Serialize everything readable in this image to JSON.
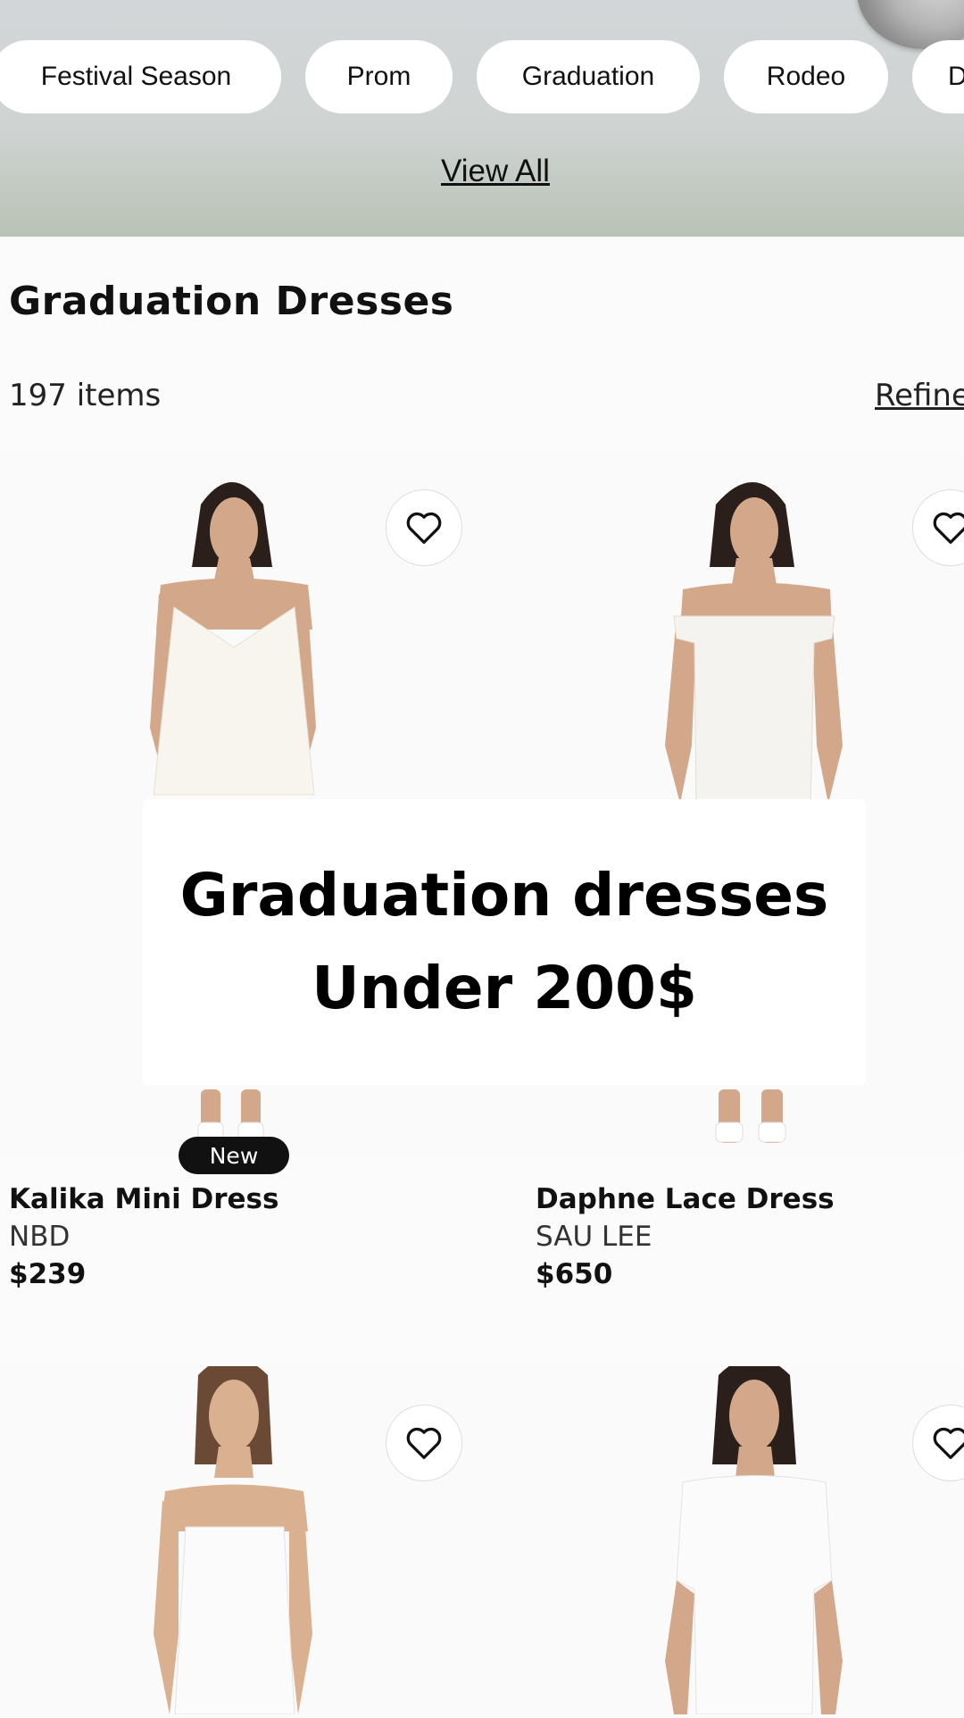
{
  "categories": {
    "chips": [
      "Festival Season",
      "Prom",
      "Graduation",
      "Rodeo",
      "D"
    ],
    "view_all": "View All"
  },
  "listing": {
    "title": "Graduation Dresses",
    "count": "197 items",
    "refine": "Refine"
  },
  "products": [
    {
      "name": "Kalika Mini Dress",
      "brand": "NBD",
      "price": "$239",
      "badge": "New"
    },
    {
      "name": "Daphne Lace Dress",
      "brand": "SAU LEE",
      "price": "$650"
    },
    {
      "name": "",
      "brand": "",
      "price": ""
    },
    {
      "name": "",
      "brand": "",
      "price": ""
    }
  ],
  "overlay": {
    "line1": "Graduation dresses",
    "line2": "Under 200$"
  },
  "colors": {
    "banner": "#cfd3d2",
    "chip": "#ffffff",
    "badge": "#111111",
    "dress": "#f7f5ee",
    "skin": "#d3a88a",
    "hair": "#2a1f1b"
  },
  "icons": [
    "heart-icon"
  ]
}
